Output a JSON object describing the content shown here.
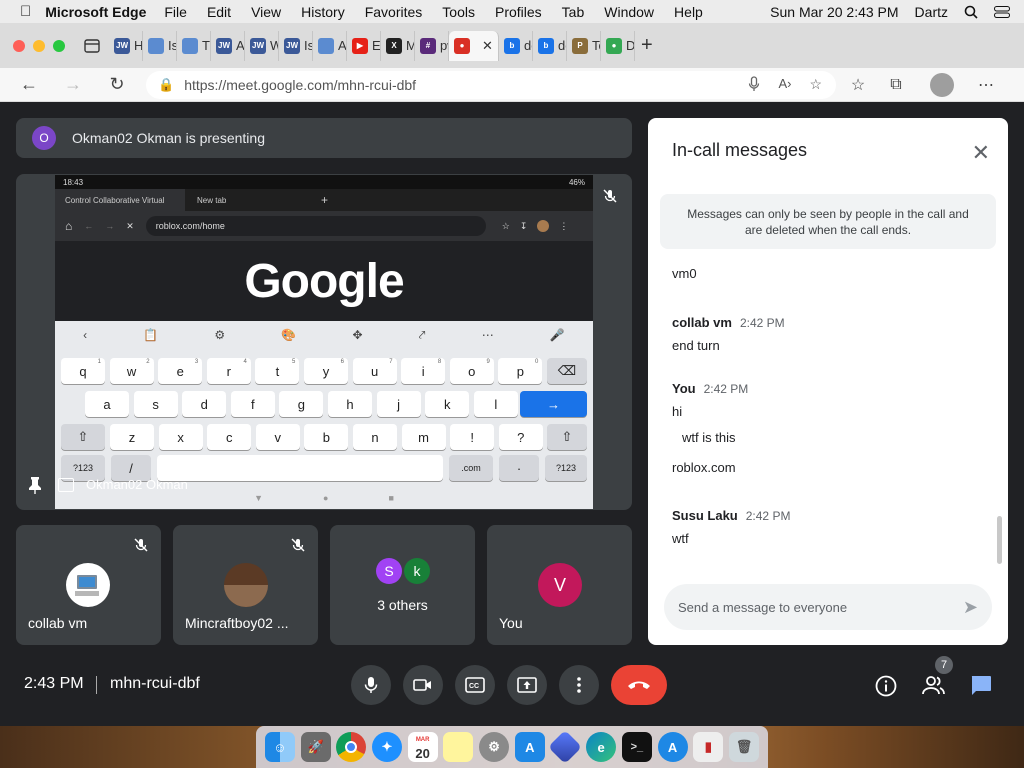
{
  "menubar": {
    "app": "Microsoft Edge",
    "menus": [
      "File",
      "Edit",
      "View",
      "History",
      "Favorites",
      "Tools",
      "Profiles",
      "Tab",
      "Window",
      "Help"
    ],
    "datetime": "Sun Mar 20  2:43 PM",
    "user": "Dartz"
  },
  "tabs": [
    {
      "icon": "JW",
      "label": "Ho",
      "color": "#3b5998"
    },
    {
      "icon": "",
      "label": "Is t",
      "color": "#5b8bd0"
    },
    {
      "icon": "",
      "label": "The",
      "color": "#5b8bd0"
    },
    {
      "icon": "JW",
      "label": "Am",
      "color": "#3b5998"
    },
    {
      "icon": "JW",
      "label": "Wh",
      "color": "#3b5998"
    },
    {
      "icon": "JW",
      "label": "Is H",
      "color": "#3b5998"
    },
    {
      "icon": "",
      "label": "An",
      "color": "#5b8bd0"
    },
    {
      "icon": "▶",
      "label": "Edi",
      "color": "#e62117"
    },
    {
      "icon": "X",
      "label": "Ma",
      "color": "#222222"
    },
    {
      "icon": "#",
      "label": "pw",
      "color": "#5a2a7a"
    },
    {
      "icon": "●",
      "label": "",
      "color": "#d93025"
    },
    {
      "icon": "b",
      "label": "do",
      "color": "#1a73e8"
    },
    {
      "icon": "b",
      "label": "do",
      "color": "#1a73e8"
    },
    {
      "icon": "P",
      "label": "Top",
      "color": "#8a6d3b"
    },
    {
      "icon": "●",
      "label": "Do",
      "color": "#34a853"
    }
  ],
  "address": {
    "url": "https://meet.google.com/mhn-rcui-dbf"
  },
  "presenting": {
    "avatar_letter": "O",
    "text": "Okman02 Okman is presenting"
  },
  "shared_screen": {
    "status_time": "18:43",
    "battery": "46%",
    "tab1": "Control Collaborative Virtual",
    "tab2": "New tab",
    "url": "roblox.com/home",
    "logo": "Google",
    "presenter_label": "Okman02 Okman",
    "rows": [
      [
        "q",
        "w",
        "e",
        "r",
        "t",
        "y",
        "u",
        "i",
        "o",
        "p"
      ],
      [
        "a",
        "s",
        "d",
        "f",
        "g",
        "h",
        "j",
        "k",
        "l"
      ],
      [
        "z",
        "x",
        "c",
        "v",
        "b",
        "n",
        "m",
        "!",
        "?"
      ]
    ],
    "digits": [
      "1",
      "2",
      "3",
      "4",
      "5",
      "6",
      "7",
      "8",
      "9",
      "0"
    ],
    "sym_key": "?123",
    "slash_key": "/",
    "com_key": ".com",
    "dot_key": "·",
    "enter_key": "→",
    "back_key": "⌫",
    "shift_key": "⇧"
  },
  "tiles": [
    {
      "name": "collab vm",
      "muted": true
    },
    {
      "name": "Mincraftboy02 ...",
      "muted": true
    },
    {
      "name": "3 others",
      "avatars": [
        {
          "letter": "S",
          "color": "#a142f4"
        },
        {
          "letter": "k",
          "color": "#188038"
        }
      ]
    },
    {
      "name": "You",
      "letter": "V",
      "color": "#c2185b"
    }
  ],
  "chat": {
    "title": "In-call messages",
    "note": "Messages can only be seen by people in the call and are deleted when the call ends.",
    "messages": [
      {
        "sender": "",
        "time": "",
        "body": "vm0"
      },
      {
        "sender": "collab vm",
        "time": "2:42 PM",
        "body": "end turn"
      },
      {
        "sender": "You",
        "time": "2:42 PM",
        "body": "hi"
      },
      {
        "sender": "",
        "time": "",
        "body": "wtf is this"
      },
      {
        "sender": "",
        "time": "",
        "body": "roblox.com"
      },
      {
        "sender": "Susu Laku",
        "time": "2:42 PM",
        "body": "wtf"
      }
    ],
    "placeholder": "Send a message to everyone"
  },
  "bottom": {
    "time": "2:43 PM",
    "code": "mhn-rcui-dbf",
    "participants_badge": "7"
  },
  "dock": {
    "calendar_day": "20",
    "calendar_month": "MAR"
  }
}
